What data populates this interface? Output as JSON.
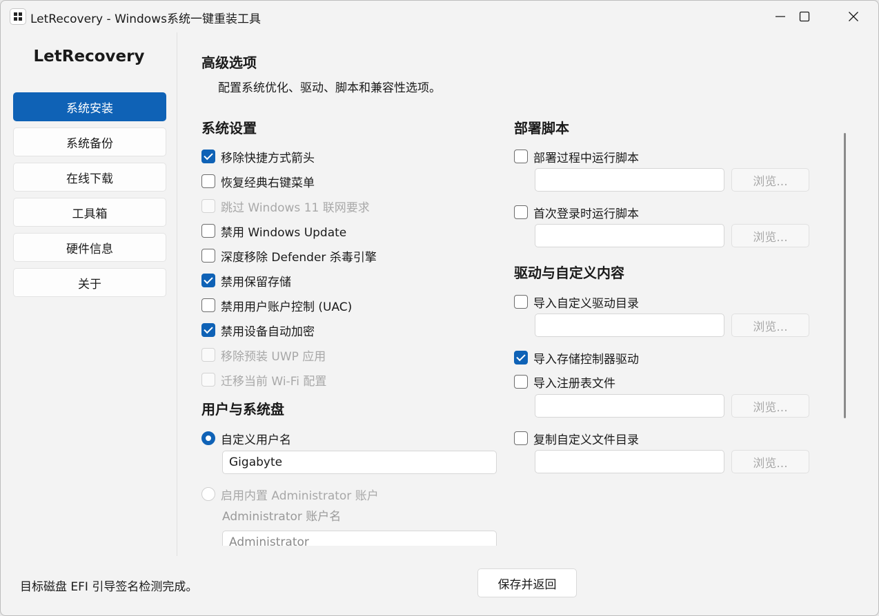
{
  "window": {
    "title": "LetRecovery - Windows系统一键重装工具"
  },
  "sidebar": {
    "brand": "LetRecovery",
    "items": [
      {
        "label": "系统安装",
        "active": true
      },
      {
        "label": "系统备份",
        "active": false
      },
      {
        "label": "在线下载",
        "active": false
      },
      {
        "label": "工具箱",
        "active": false
      },
      {
        "label": "硬件信息",
        "active": false
      },
      {
        "label": "关于",
        "active": false
      }
    ]
  },
  "main": {
    "title": "高级选项",
    "subtitle": "配置系统优化、驱动、脚本和兼容性选项。",
    "system_settings": {
      "title": "系统设置",
      "options": [
        {
          "label": "移除快捷方式箭头",
          "checked": true,
          "disabled": false
        },
        {
          "label": "恢复经典右键菜单",
          "checked": false,
          "disabled": false
        },
        {
          "label": "跳过 Windows 11 联网要求",
          "checked": false,
          "disabled": true
        },
        {
          "label": "禁用 Windows Update",
          "checked": false,
          "disabled": false
        },
        {
          "label": "深度移除 Defender 杀毒引擎",
          "checked": false,
          "disabled": false
        },
        {
          "label": "禁用保留存储",
          "checked": true,
          "disabled": false
        },
        {
          "label": "禁用用户账户控制 (UAC)",
          "checked": false,
          "disabled": false
        },
        {
          "label": "禁用设备自动加密",
          "checked": true,
          "disabled": false
        },
        {
          "label": "移除预装 UWP 应用",
          "checked": false,
          "disabled": true
        },
        {
          "label": "迁移当前 Wi-Fi 配置",
          "checked": false,
          "disabled": true
        }
      ]
    },
    "user_disk": {
      "title": "用户与系统盘",
      "custom_username": {
        "label": "自定义用户名",
        "selected": true,
        "value": "Gigabyte"
      },
      "builtin_admin": {
        "label": "启用内置 Administrator 账户",
        "selected": false,
        "disabled": true
      },
      "admin_name_label": "Administrator 账户名",
      "admin_name_value": "Administrator"
    },
    "deploy_scripts": {
      "title": "部署脚本",
      "run_during_deploy": {
        "label": "部署过程中运行脚本",
        "checked": false,
        "value": ""
      },
      "run_first_logon": {
        "label": "首次登录时运行脚本",
        "checked": false,
        "value": ""
      }
    },
    "drivers_custom": {
      "title": "驱动与自定义内容",
      "import_driver_dir": {
        "label": "导入自定义驱动目录",
        "checked": false,
        "value": ""
      },
      "import_storage_driver": {
        "label": "导入存储控制器驱动",
        "checked": true
      },
      "import_reg": {
        "label": "导入注册表文件",
        "checked": false,
        "value": ""
      },
      "copy_custom_dir": {
        "label": "复制自定义文件目录",
        "checked": false,
        "value": ""
      }
    },
    "browse_label": "浏览..."
  },
  "footer": {
    "status": "目标磁盘 EFI 引导签名检测完成。",
    "save_label": "保存并返回"
  },
  "colors": {
    "accent": "#0f62b6",
    "background": "#f3f3f3",
    "disabled_text": "#a8a8a8"
  }
}
